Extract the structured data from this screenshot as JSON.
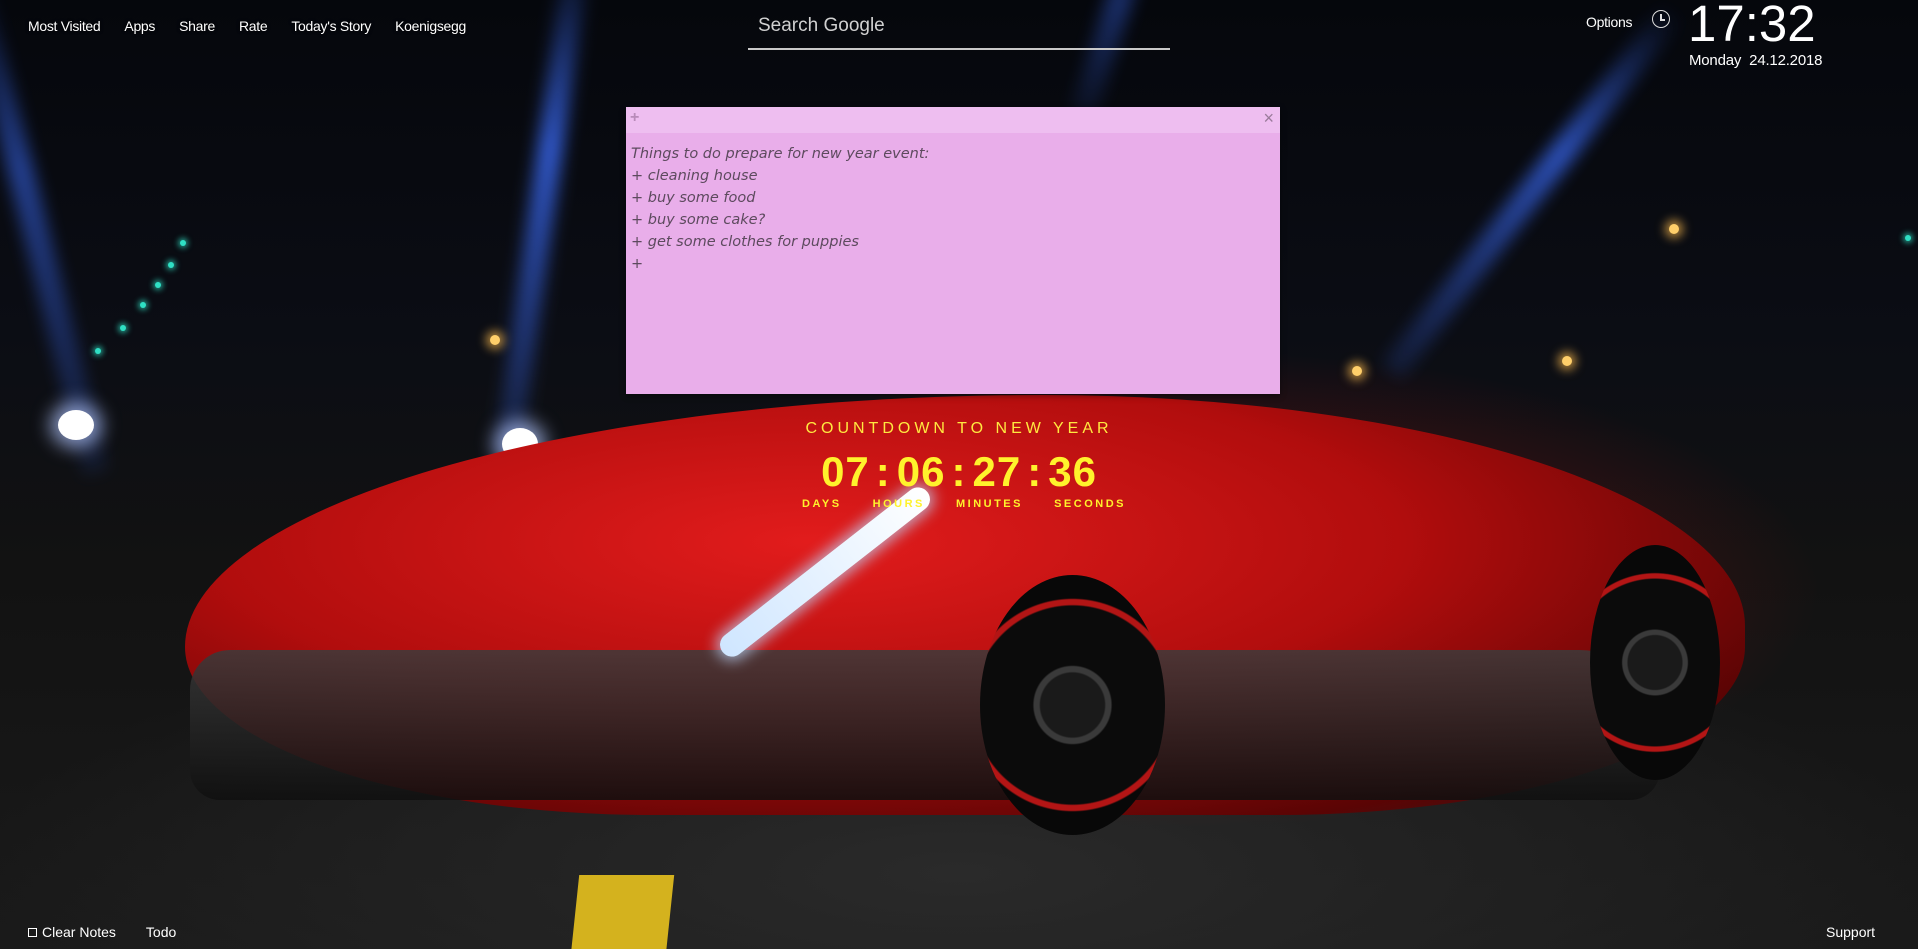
{
  "topnav": {
    "items": [
      "Most Visited",
      "Apps",
      "Share",
      "Rate",
      "Today's Story",
      "Koenigsegg"
    ]
  },
  "search": {
    "placeholder": "Search Google"
  },
  "header": {
    "options_label": "Options",
    "time": "17:32",
    "weekday": "Monday",
    "date": "24.12.2018"
  },
  "note": {
    "lines": [
      "Things to do prepare for new year event:",
      "+ cleaning house",
      "+ buy some food",
      "+ buy some cake?",
      "+ get some clothes for puppies",
      "+"
    ],
    "add_icon": "+",
    "close_icon": "×"
  },
  "countdown": {
    "title": "COUNTDOWN TO NEW YEAR",
    "days": "07",
    "hours": "06",
    "minutes": "27",
    "seconds": "36",
    "labels": [
      "DAYS",
      "HOURS",
      "MINUTES",
      "SECONDS"
    ]
  },
  "footer": {
    "clear_notes": "Clear Notes",
    "todo": "Todo",
    "support": "Support"
  },
  "colors": {
    "note_bg": "#e9aeea",
    "countdown_yellow": "#fff22c"
  }
}
